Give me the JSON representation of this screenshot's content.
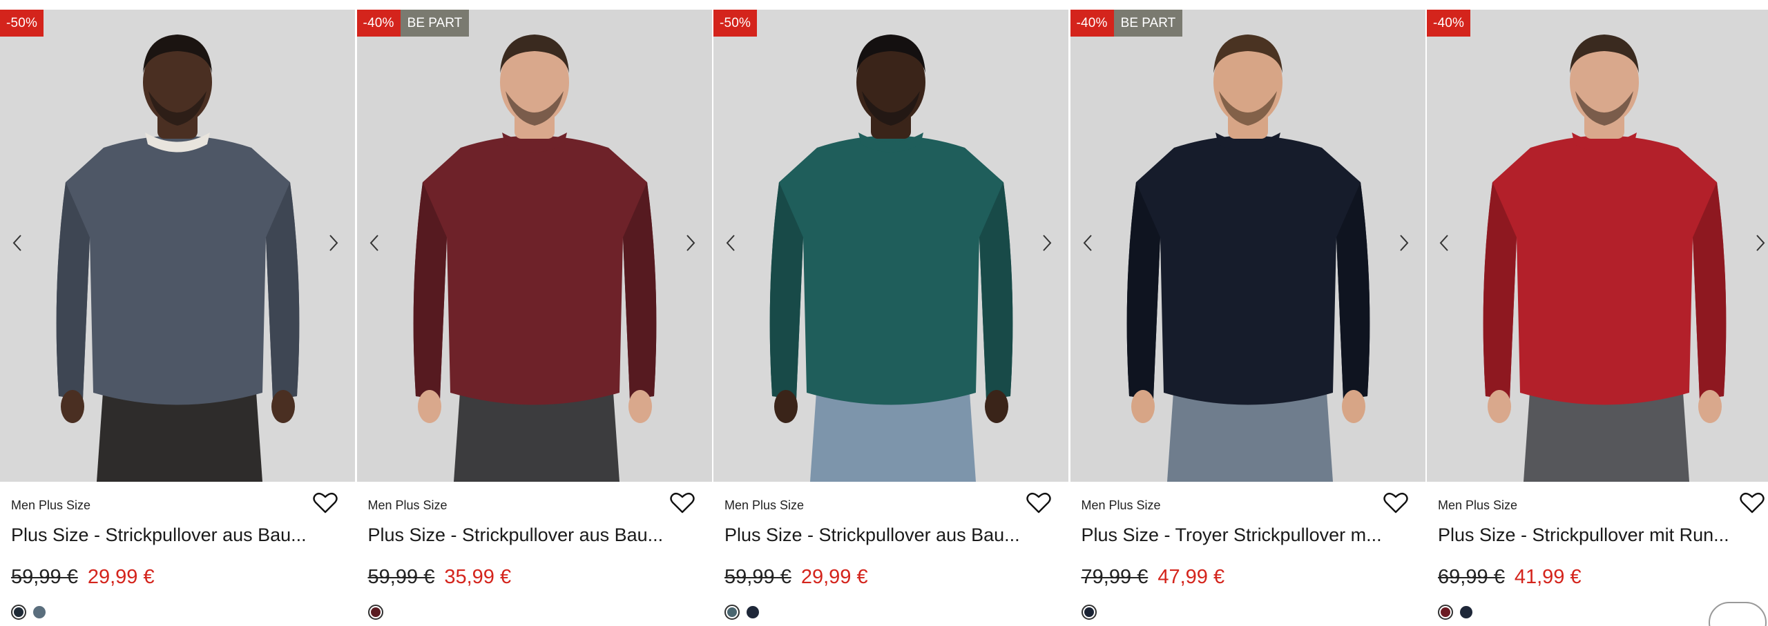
{
  "products": [
    {
      "discount": "-50%",
      "tag": "",
      "brand": "Men Plus Size",
      "title": "Plus Size - Strickpullover aus Bau...",
      "price_old": "59,99 €",
      "price_new": "29,99 €",
      "photo": {
        "bg": "#d8d8d8",
        "sweater": "#4e5766",
        "sweater_shade": "#3e4653",
        "skin": "#4a2f22",
        "hair": "#1b1411",
        "pants": "#2e2c2b",
        "collar": "#e8e4dd"
      },
      "swatches": [
        {
          "color": "#1f2a36",
          "selected": true
        },
        {
          "color": "#5a6e7d",
          "selected": false
        }
      ]
    },
    {
      "discount": "-40%",
      "tag": "BE PART",
      "brand": "Men Plus Size",
      "title": "Plus Size - Strickpullover aus Bau...",
      "price_old": "59,99 €",
      "price_new": "35,99 €",
      "photo": {
        "bg": "#d6d6d6",
        "sweater": "#6e2229",
        "sweater_shade": "#561a20",
        "skin": "#d9a88c",
        "hair": "#3a2a1f",
        "pants": "#3c3c3e",
        "collar": "#6e2229"
      },
      "swatches": [
        {
          "color": "#5a1c22",
          "selected": true
        }
      ]
    },
    {
      "discount": "-50%",
      "tag": "",
      "brand": "Men Plus Size",
      "title": "Plus Size - Strickpullover aus Bau...",
      "price_old": "59,99 €",
      "price_new": "29,99 €",
      "photo": {
        "bg": "#d8d8d8",
        "sweater": "#1f5e5b",
        "sweater_shade": "#184a48",
        "skin": "#3a2419",
        "hair": "#141010",
        "pants": "#7d95ab",
        "collar": "#1f5e5b"
      },
      "swatches": [
        {
          "color": "#4a6670",
          "selected": true
        },
        {
          "color": "#1e2738",
          "selected": false
        }
      ]
    },
    {
      "discount": "-40%",
      "tag": "BE PART",
      "brand": "Men Plus Size",
      "title": "Plus Size - Troyer Strickpullover m...",
      "price_old": "79,99 €",
      "price_new": "47,99 €",
      "photo": {
        "bg": "#d6d6d6",
        "sweater": "#161c2b",
        "sweater_shade": "#0f1420",
        "skin": "#d7a586",
        "hair": "#4a3322",
        "pants": "#6f7d8d",
        "collar": "#161c2b"
      },
      "swatches": [
        {
          "color": "#1a2233",
          "selected": true
        }
      ]
    },
    {
      "discount": "-40%",
      "tag": "",
      "brand": "Men Plus Size",
      "title": "Plus Size - Strickpullover mit Run...",
      "price_old": "69,99 €",
      "price_new": "41,99 €",
      "photo": {
        "bg": "#d7d7d7",
        "sweater": "#b3202a",
        "sweater_shade": "#8e1820",
        "skin": "#d9a88c",
        "hair": "#3a2a1f",
        "pants": "#56575b",
        "collar": "#b3202a"
      },
      "swatches": [
        {
          "color": "#6b1a22",
          "selected": true
        },
        {
          "color": "#1e2738",
          "selected": false
        }
      ]
    }
  ],
  "icons": {
    "prev": "chevron-left-icon",
    "next": "chevron-right-icon",
    "wishlist": "heart-outline-icon"
  }
}
